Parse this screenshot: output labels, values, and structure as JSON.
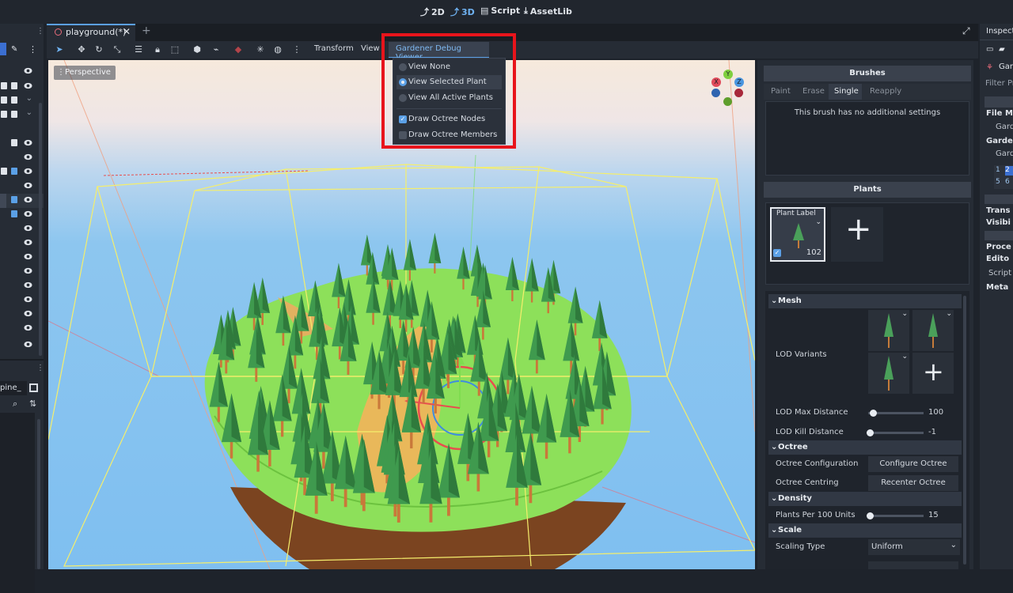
{
  "workspace": {
    "items": [
      {
        "label": "2D",
        "icon": "2d-icon"
      },
      {
        "label": "3D",
        "icon": "3d-icon",
        "active": true
      },
      {
        "label": "Script",
        "icon": "script-icon"
      },
      {
        "label": "AssetLib",
        "icon": "assetlib-icon"
      }
    ]
  },
  "scene_tab": {
    "label": "playground(*)"
  },
  "toolbar": {
    "transform": "Transform",
    "view": "View",
    "plugin_menu": "Gardener Debug Viewer"
  },
  "viewport": {
    "perspective_label": "Perspective",
    "gizmo": {
      "x": "X",
      "y": "Y",
      "z": "Z"
    }
  },
  "debug_menu": {
    "items": [
      {
        "label": "View None",
        "type": "radio",
        "checked": false
      },
      {
        "label": "View Selected Plant",
        "type": "radio",
        "checked": true
      },
      {
        "label": "View All Active Plants",
        "type": "radio",
        "checked": false
      },
      {
        "label": "Draw Octree Nodes",
        "type": "check",
        "checked": true
      },
      {
        "label": "Draw Octree Members",
        "type": "check",
        "checked": false
      }
    ]
  },
  "left_dock": {
    "filter_text": "pine_"
  },
  "brushes": {
    "title": "Brushes",
    "tabs": [
      "Paint",
      "Erase",
      "Single",
      "Reapply"
    ],
    "active_tab": "Single",
    "message": "This brush has no additional settings"
  },
  "plants": {
    "title": "Plants",
    "card": {
      "label": "Plant Label",
      "count": "102"
    },
    "add_symbol": "+"
  },
  "props": {
    "mesh_header": "Mesh",
    "lod_variants": "LOD Variants",
    "lod_max_distance": {
      "label": "LOD Max Distance",
      "value": "100"
    },
    "lod_kill_distance": {
      "label": "LOD Kill Distance",
      "value": "-1"
    },
    "octree_header": "Octree",
    "octree_config": {
      "label": "Octree Configuration",
      "button": "Configure Octree"
    },
    "octree_centring": {
      "label": "Octree Centring",
      "button": "Recenter Octree"
    },
    "density_header": "Density",
    "plants_per": {
      "label": "Plants Per 100 Units",
      "value": "15"
    },
    "scale_header": "Scale",
    "scaling_type": {
      "label": "Scaling Type",
      "value": "Uniform"
    }
  },
  "inspector": {
    "title": "Inspect",
    "node_label": "Gard",
    "filter": "Filter Pr",
    "rows": [
      "File M",
      "Gard",
      "Garde",
      "Gard",
      "Trans",
      "Visibi",
      "Proce",
      "Edito",
      "Script",
      "Meta"
    ],
    "nums": [
      "1",
      "2",
      "5",
      "6"
    ]
  },
  "colors": {
    "accent": "#5ba0e6",
    "highlight": "#e8141b",
    "panel": "#262c35"
  }
}
